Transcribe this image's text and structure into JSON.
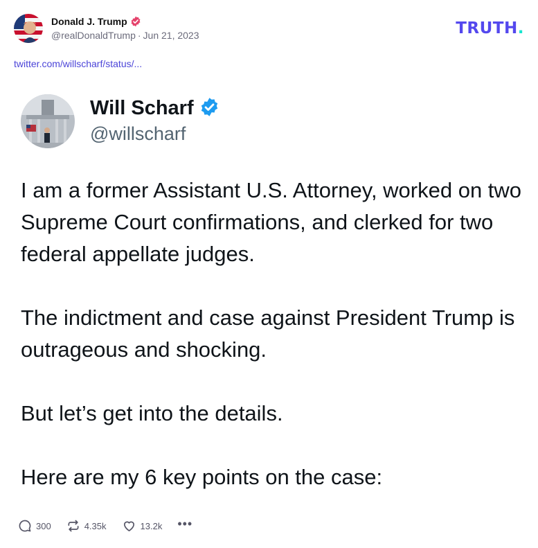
{
  "post": {
    "author_name": "Donald J. Trump",
    "handle": "@realDonaldTrump",
    "separator": "·",
    "date": "Jun 21, 2023",
    "link": "twitter.com/willscharf/status/..."
  },
  "brand": {
    "logo_text": "TRUTH",
    "logo_dot": ".",
    "color": "#5448ee",
    "dot_color": "#17e5cf"
  },
  "tweet": {
    "name": "Will Scharf",
    "handle": "@willscharf",
    "paragraphs": [
      "I am a former Assistant U.S. Attorney, worked on two Supreme Court confirmations, and clerked for two federal appellate judges.",
      "The indictment and case against President Trump is outrageous and shocking.",
      "But let’s get into the details.",
      "Here are my 6 key points on the case:"
    ]
  },
  "actions": {
    "replies": "300",
    "retruths": "4.35k",
    "likes": "13.2k",
    "more": "•••"
  },
  "icons": {
    "verified_post": "verified-badge-red-icon",
    "verified_tweet": "verified-badge-blue-icon",
    "reply": "reply-icon",
    "retruth": "retruth-icon",
    "like": "heart-icon",
    "more": "more-icon"
  }
}
